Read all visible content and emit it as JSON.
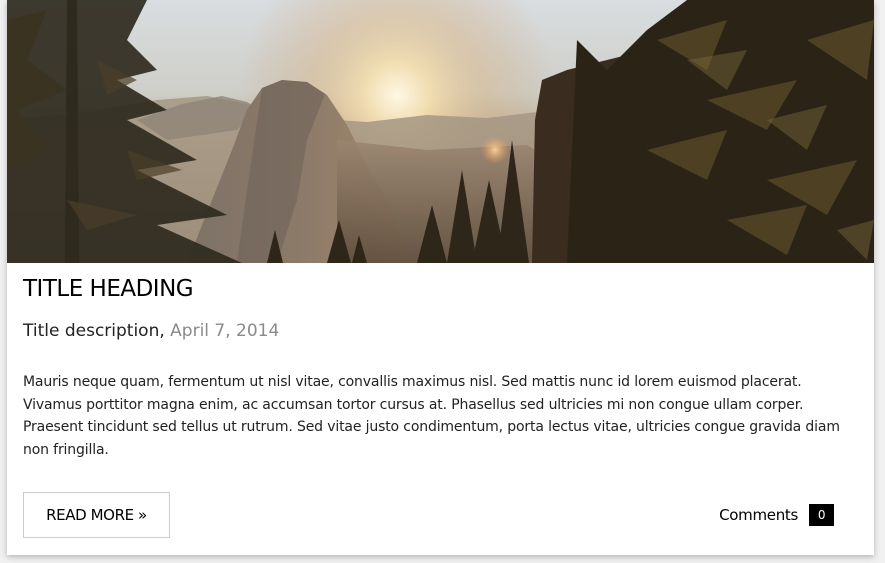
{
  "post": {
    "title": "TITLE HEADING",
    "description": "Title description,",
    "date": "April 7, 2014",
    "body": "Mauris neque quam, fermentum ut nisl vitae, convallis maximus nisl. Sed mattis nunc id lorem euismod placerat. Vivamus porttitor magna enim, ac accumsan tortor cursus at. Phasellus sed ultricies mi non congue ullam corper. Praesent tincidunt sed tellus ut rutrum. Sed vitae justo condimentum, porta lectus vitae, ultricies congue gravida diam non fringilla.",
    "read_more_label": "READ MORE »",
    "comments_label": "Comments",
    "comments_count": "0"
  },
  "colors": {
    "accent": "#000000",
    "date_gray": "#8a8a8a",
    "border": "#cccccc"
  }
}
